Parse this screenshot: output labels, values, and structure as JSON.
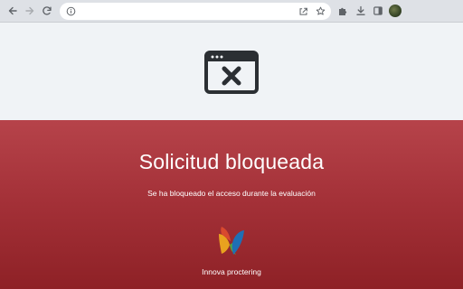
{
  "browser": {
    "back_icon": "arrow-left-icon",
    "forward_icon": "arrow-right-icon",
    "reload_icon": "reload-icon",
    "site_info_icon": "info-icon",
    "share_icon": "share-icon",
    "bookmark_icon": "star-icon",
    "extensions_icon": "puzzle-icon",
    "downloads_icon": "download-icon",
    "side_panel_icon": "side-panel-icon",
    "profile_icon": "avatar"
  },
  "page": {
    "icon": "blocked-window-icon",
    "title": "Solicitud bloqueada",
    "message": "Se ha bloqueado el acceso durante la evaluación",
    "brand": "Innova proctering"
  },
  "colors": {
    "top_band": "#f0f3f6",
    "red_band_top": "#b6434a",
    "red_band_bottom": "#8e2126",
    "icon_dark": "#2b2f33",
    "text": "#ffffff"
  }
}
